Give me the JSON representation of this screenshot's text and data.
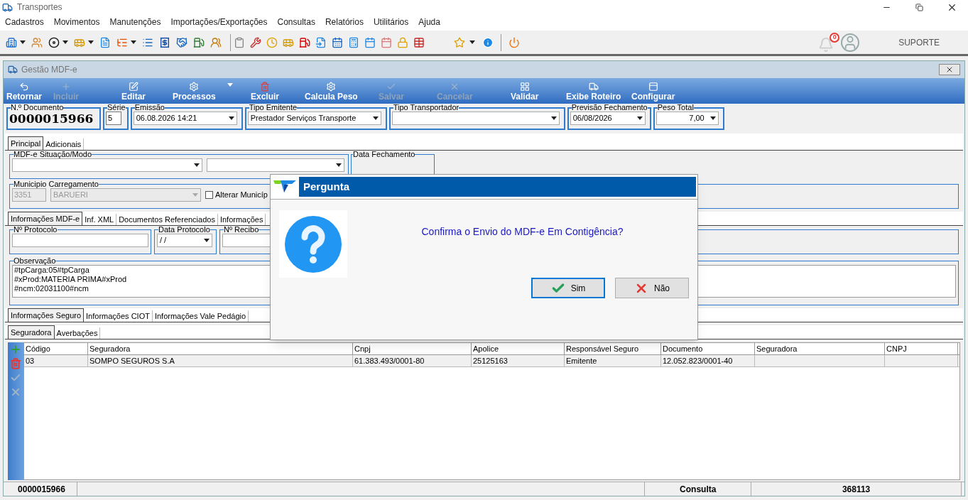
{
  "window": {
    "title": "Transportes"
  },
  "menu": [
    "Cadastros",
    "Movimentos",
    "Manutenções",
    "Importações/Exportações",
    "Consultas",
    "Relatórios",
    "Utilitários",
    "Ajuda"
  ],
  "user": {
    "notifications": "0",
    "name": "SUPORTE"
  },
  "child_window": {
    "title": "Gestão MDF-e"
  },
  "toolbar": [
    {
      "label": "Retornar",
      "disabled": false,
      "dropdown": false
    },
    {
      "label": "Incluir",
      "disabled": true,
      "dropdown": false
    },
    {
      "label": "Editar",
      "disabled": false,
      "dropdown": false
    },
    {
      "label": "Processos",
      "disabled": false,
      "dropdown": true
    },
    {
      "label": "Excluir",
      "disabled": false,
      "dropdown": false
    },
    {
      "label": "Calcula Peso",
      "disabled": false,
      "dropdown": false
    },
    {
      "label": "Salvar",
      "disabled": true,
      "dropdown": false
    },
    {
      "label": "Cancelar",
      "disabled": true,
      "dropdown": false
    },
    {
      "label": "Validar",
      "disabled": false,
      "dropdown": false
    },
    {
      "label": "Exibe Roteiro",
      "disabled": false,
      "dropdown": false
    },
    {
      "label": "Configurar",
      "disabled": false,
      "dropdown": false
    }
  ],
  "header": [
    {
      "label": "N.º Documento",
      "value": "0000015966",
      "kind": "display"
    },
    {
      "label": "Série",
      "value": "5",
      "kind": "text"
    },
    {
      "label": "Emissão",
      "value": "06.08.2026 14:21",
      "kind": "combo"
    },
    {
      "label": "Tipo Emitente",
      "value": "Prestador Serviços Transporte",
      "kind": "combo"
    },
    {
      "label": "Tipo Transportador",
      "kind": "combo"
    },
    {
      "label": "Previsão Fechamento",
      "value": "06/08/2026",
      "kind": "combo"
    },
    {
      "label": "Peso Total",
      "value": "7,00",
      "kind": "combo"
    }
  ],
  "main_tabs": [
    {
      "label": "Principal",
      "selected": true
    },
    {
      "label": "Adicionais",
      "selected": false
    }
  ],
  "situacao": {
    "label": "MDF-e Situação/Modo"
  },
  "data_fechamento": {
    "label": "Data Fechamento"
  },
  "municipio": {
    "label": "Municipio Carregamento",
    "code": "3351",
    "name": "BARUERI",
    "disabled": true,
    "alterar": {
      "label": "Alterar Municíp",
      "checked": false
    }
  },
  "info_tabs": [
    {
      "label": "Informações MDF-e",
      "selected": true
    },
    {
      "label": "Inf. XML",
      "selected": false
    },
    {
      "label": "Documentos Referenciados",
      "selected": false
    },
    {
      "label": "Informações",
      "selected": false
    }
  ],
  "protocolo": {
    "label": "Nº Protocolo"
  },
  "data_protocolo": {
    "label": "Data Protocolo",
    "value": "/ /"
  },
  "recibo": {
    "label": "Nº Recibo"
  },
  "observacao": {
    "label": "Observação",
    "lines": [
      "#tpCarga:05#tpCarga",
      "#xProd:MATERIA PRIMA#xProd",
      "#ncm:02031100#ncm"
    ]
  },
  "seguro_tabs": [
    {
      "label": "Informações Seguro",
      "selected": true
    },
    {
      "label": "Informações CIOT",
      "selected": false
    },
    {
      "label": "Informações Vale Pedágio",
      "selected": false
    }
  ],
  "sub_tabs": [
    {
      "label": "Seguradora",
      "selected": true
    },
    {
      "label": "Averbações",
      "selected": false
    }
  ],
  "side_actions": [
    {
      "kind": "add",
      "disabled": false
    },
    {
      "kind": "delete",
      "disabled": false
    },
    {
      "kind": "confirm",
      "disabled": true
    },
    {
      "kind": "cancel",
      "disabled": true
    }
  ],
  "table": {
    "columns": [
      "Código",
      "Seguradora",
      "Cnpj",
      "Apolice",
      "Responsável Seguro",
      "Documento",
      "Seguradora",
      "CNPJ"
    ],
    "rows": [
      {
        "cells": [
          "03",
          "SOMPO SEGUROS S.A",
          "61.383.493/0001-80",
          "25125163",
          "Emitente",
          "12.052.823/0001-40"
        ]
      }
    ]
  },
  "status_bar": [
    {
      "text": "0000015966"
    },
    {
      "text": "Consulta"
    },
    {
      "text": "368113"
    }
  ],
  "dialog": {
    "title": "Pergunta",
    "message": "Confirma o Envio do MDF-e Em Contigência?",
    "buttons": [
      {
        "label": "Sim",
        "kind": "ok",
        "focused": true
      },
      {
        "label": "Não",
        "kind": "cancel",
        "focused": false
      }
    ]
  }
}
